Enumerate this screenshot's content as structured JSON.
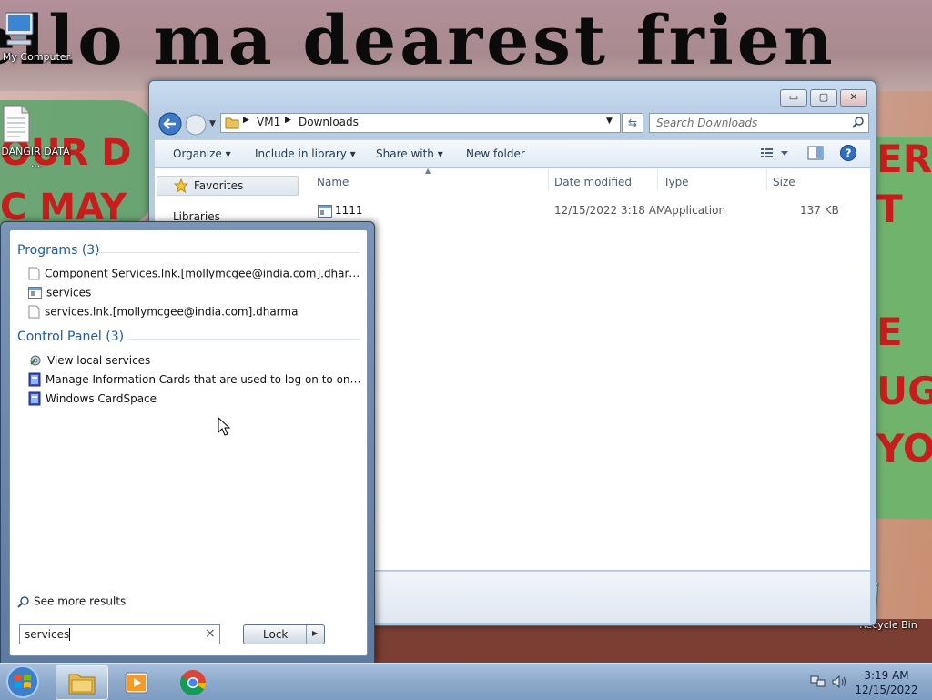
{
  "wallpaper": {
    "headline": "ello ma dearest frien",
    "red_fragments": [
      "OUR D",
      "C MAY",
      "ER",
      "T",
      "E",
      "UG",
      "YO"
    ]
  },
  "desktop": {
    "icons": [
      {
        "label": "My Computer"
      },
      {
        "label": "DANGIR DATA ..."
      },
      {
        "label": "Recycle Bin"
      }
    ]
  },
  "explorer": {
    "address": {
      "crumbs": [
        "VM1",
        "Downloads"
      ]
    },
    "search_placeholder": "Search Downloads",
    "caption_buttons": {
      "minimize": "▭",
      "maximize": "▢",
      "close": "✕"
    },
    "toolbar": {
      "organize": "Organize",
      "include_in_library": "Include in library",
      "share_with": "Share with",
      "new_folder": "New folder"
    },
    "nav": {
      "favorites": "Favorites",
      "libraries": "Libraries"
    },
    "columns": [
      "Name",
      "Date modified",
      "Type",
      "Size"
    ],
    "files": [
      {
        "name": "1111",
        "date_modified": "12/15/2022 3:18 AM",
        "type": "Application",
        "size": "137 KB"
      }
    ]
  },
  "start_menu": {
    "groups": [
      {
        "title": "Programs (3)",
        "items": [
          {
            "label": "Component Services.lnk.[mollymcgee@india.com].dharma",
            "icon": "blank-file-icon"
          },
          {
            "label": "services",
            "icon": "application-icon"
          },
          {
            "label": "services.lnk.[mollymcgee@india.com].dharma",
            "icon": "blank-file-icon"
          }
        ]
      },
      {
        "title": "Control Panel (3)",
        "items": [
          {
            "label": "View local services",
            "icon": "services-gear-icon"
          },
          {
            "label": "Manage Information Cards that are used to log on to online ser...",
            "icon": "cardspace-icon"
          },
          {
            "label": "Windows CardSpace",
            "icon": "cardspace-icon"
          }
        ]
      }
    ],
    "see_more": "See more results",
    "search_value": "services",
    "clear_glyph": "×",
    "lock_label": "Lock",
    "lock_arrow": "▶"
  },
  "taskbar": {
    "clock": {
      "time": "3:19 AM",
      "date": "12/15/2022"
    }
  }
}
